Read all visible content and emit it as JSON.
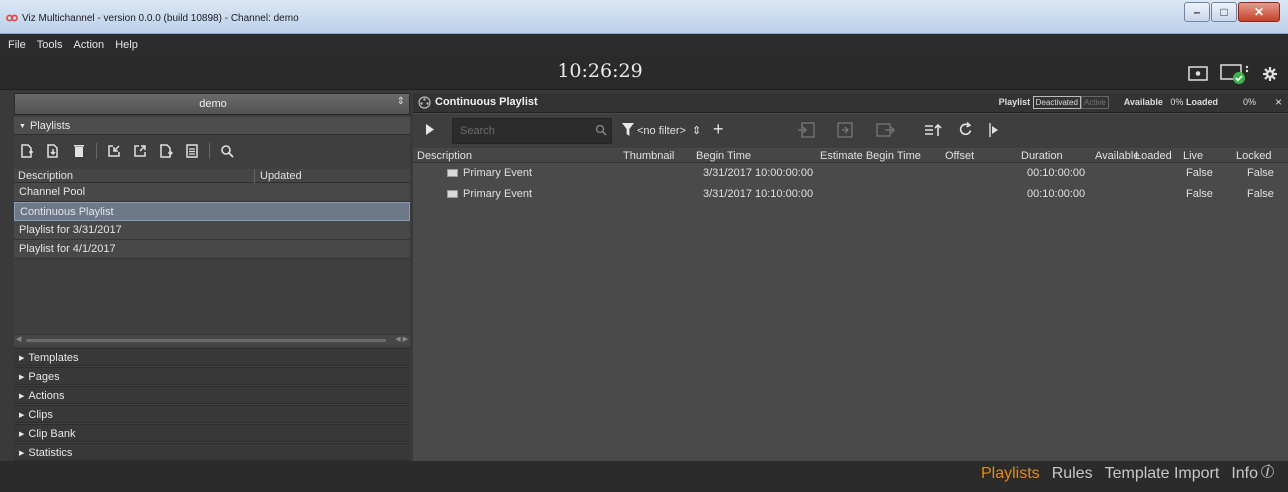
{
  "window": {
    "title": "Viz Multichannel - version 0.0.0 (build 10898) -  Channel: demo",
    "minimize_glyph": "–",
    "maximize_glyph": "□",
    "close_glyph": "✕"
  },
  "menu": [
    "File",
    "Tools",
    "Action",
    "Help"
  ],
  "clock": "10:26:29",
  "left": {
    "channel": "demo",
    "playlists_header": "Playlists",
    "table_headers": {
      "description": "Description",
      "updated": "Updated"
    },
    "playlists": [
      {
        "label": "Channel Pool",
        "selected": false
      },
      {
        "label": "Continuous Playlist",
        "selected": true
      },
      {
        "label": "Playlist for 3/31/2017",
        "selected": false
      },
      {
        "label": "Playlist for 4/1/2017",
        "selected": false
      }
    ],
    "sections": [
      "Templates",
      "Pages",
      "Actions",
      "Clips",
      "Clip Bank",
      "Statistics"
    ]
  },
  "right": {
    "title": "Continuous Playlist",
    "playlist_label": "Playlist",
    "deactivated": "Deactivated",
    "active": "Active",
    "available_label": "Available",
    "available_value": "0%",
    "loaded_label": "Loaded",
    "loaded_value": "0%",
    "close_glyph": "×",
    "search_placeholder": "Search",
    "filter": "<no filter>",
    "filter_arrows": "⇕",
    "add_glyph": "+",
    "columns": {
      "description": "Description",
      "thumbnail": "Thumbnail",
      "begin_time": "Begin Time",
      "estimate_begin_time": "Estimate Begin Time",
      "offset": "Offset",
      "duration": "Duration",
      "available": "Availablе",
      "loaded": "Loaded",
      "live": "Live",
      "locked": "Locked"
    },
    "rows": [
      {
        "description": "Primary Event",
        "begin_time": "3/31/2017 10:00:00:00",
        "duration": "00:10:00:00",
        "live": "False",
        "locked": "False"
      },
      {
        "description": "Primary Event",
        "begin_time": "3/31/2017 10:10:00:00",
        "duration": "00:10:00:00",
        "live": "False",
        "locked": "False"
      }
    ]
  },
  "bottom_tabs": [
    {
      "label": "Playlists",
      "active": true
    },
    {
      "label": "Rules",
      "active": false
    },
    {
      "label": "Template Import",
      "active": false
    },
    {
      "label": "Info",
      "active": false
    }
  ],
  "colors": {
    "accent": "#e58a1a",
    "selection": "#6d7889",
    "ok_green": "#3bb54a"
  }
}
